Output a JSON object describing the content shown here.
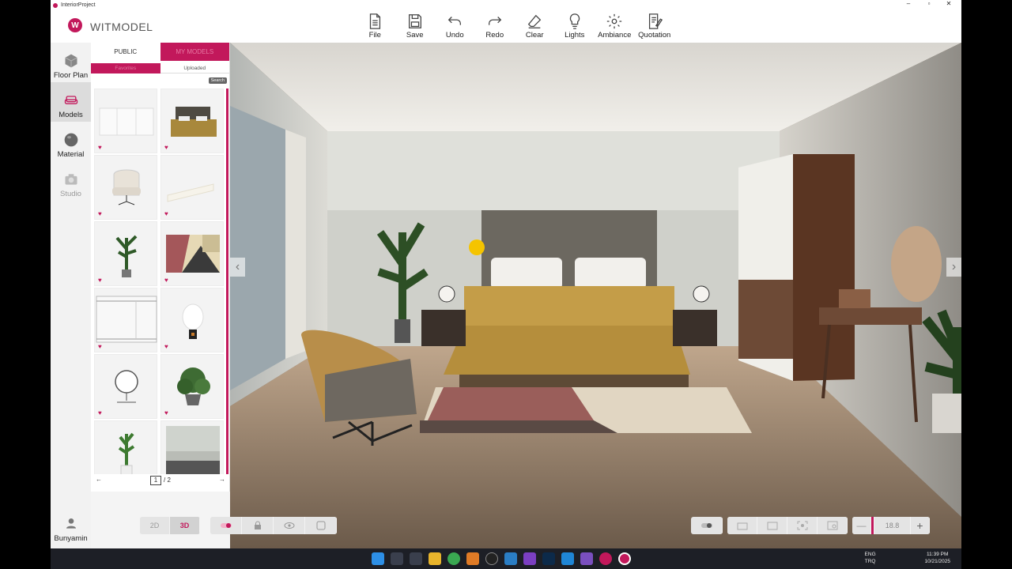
{
  "window": {
    "title": "InteriorProject",
    "minimize": "–",
    "maximize": "▫",
    "close": "✕"
  },
  "brand": {
    "logo_letter": "W",
    "name": "WITMODEL",
    "accent": "#c2185b"
  },
  "toolbar": [
    {
      "label": "File",
      "icon": "file-icon"
    },
    {
      "label": "Save",
      "icon": "save-icon"
    },
    {
      "label": "Undo",
      "icon": "undo-icon"
    },
    {
      "label": "Redo",
      "icon": "redo-icon"
    },
    {
      "label": "Clear",
      "icon": "eraser-icon"
    },
    {
      "label": "Lights",
      "icon": "lightbulb-icon"
    },
    {
      "label": "Ambiance",
      "icon": "gear-icon"
    },
    {
      "label": "Quotation",
      "icon": "quotation-icon"
    }
  ],
  "nav": [
    {
      "label": "Floor Plan",
      "icon": "cube-icon"
    },
    {
      "label": "Models",
      "icon": "sofa-icon",
      "active": true
    },
    {
      "label": "Material",
      "icon": "sphere-icon"
    },
    {
      "label": "Studio",
      "icon": "camera-icon",
      "disabled": true
    }
  ],
  "user": {
    "name": "Bunyamin"
  },
  "panel": {
    "tabs": [
      "PUBLIC",
      "MY MODELS"
    ],
    "subtabs": [
      "Favorites",
      "Uploaded"
    ],
    "search_label": "Search",
    "items": [
      {
        "name": "wardrobe",
        "favorite": "♥"
      },
      {
        "name": "bed",
        "favorite": "♥"
      },
      {
        "name": "armchair",
        "favorite": "♥"
      },
      {
        "name": "bench",
        "favorite": "♥"
      },
      {
        "name": "potted-plant",
        "favorite": "♥"
      },
      {
        "name": "rug",
        "favorite": "♥"
      },
      {
        "name": "sliding-wardrobe",
        "favorite": "♥"
      },
      {
        "name": "table-lamp",
        "favorite": "♥"
      },
      {
        "name": "vanity-mirror",
        "favorite": "♥"
      },
      {
        "name": "bush-plant",
        "favorite": "♥"
      },
      {
        "name": "small-plant",
        "favorite": ""
      },
      {
        "name": "cabinet",
        "favorite": ""
      }
    ],
    "pager": {
      "prev": "←",
      "current": "1",
      "total": "/ 2",
      "next": "→"
    }
  },
  "view_controls": {
    "mode": [
      "2D",
      "3D"
    ],
    "zoom_value": "18.8",
    "zoom_minus": "—",
    "zoom_plus": "+"
  },
  "taskbar": {
    "lang": "ENG",
    "region": "TRQ",
    "time": "11:39 PM",
    "date": "10/21/2025"
  }
}
